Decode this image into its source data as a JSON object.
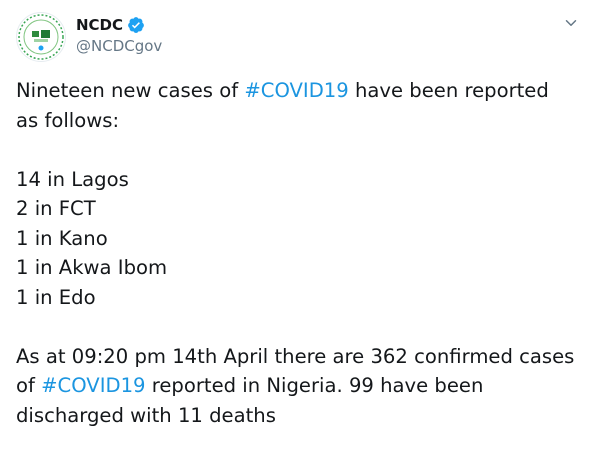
{
  "account": {
    "display_name": "NCDC",
    "handle": "@NCDCgov",
    "verified": true,
    "avatar_icon": "ncdc-logo-icon"
  },
  "menu_icon": "chevron-down-icon",
  "tweet": {
    "intro_prefix": "Nineteen new cases of ",
    "intro_hashtag": "#COVID19",
    "intro_suffix": " have been reported",
    "intro_line2": "as follows:",
    "cases": [
      "14 in Lagos",
      "2 in FCT",
      "1 in Kano",
      "1 in Akwa Ibom",
      "1 in Edo"
    ],
    "summary_line1": "As at 09:20 pm 14th April there are 362 confirmed cases",
    "summary_prefix": "of ",
    "summary_hashtag": "#COVID19",
    "summary_suffix": " reported in Nigeria. 99 have been",
    "summary_line3": "discharged with 11 deaths"
  },
  "colors": {
    "text": "#14171a",
    "secondary": "#657786",
    "link": "#1b95e0",
    "verified": "#1da1f2"
  }
}
